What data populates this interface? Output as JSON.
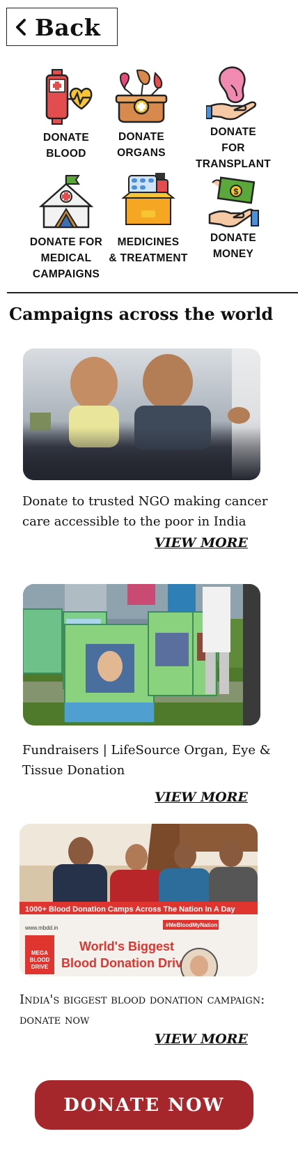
{
  "nav": {
    "back_label": "Back"
  },
  "categories": [
    {
      "label": "DONATE\nBLOOD",
      "icon": "blood-bag-icon"
    },
    {
      "label": "DONATE\nORGANS",
      "icon": "organs-box-icon"
    },
    {
      "label": "DONATE\nFOR\nTRANSPLANT",
      "icon": "kidney-hand-icon"
    },
    {
      "label": "DONATE FOR\nMEDICAL\nCAMPAIGNS",
      "icon": "medical-tent-icon"
    },
    {
      "label": "MEDICINES\n& TREATMENT",
      "icon": "medicine-box-icon"
    },
    {
      "label": "DONATE\nMONEY",
      "icon": "money-hand-icon"
    }
  ],
  "section": {
    "title": "Campaigns across the world"
  },
  "campaigns": [
    {
      "description": "Donate to trusted NGO making cancer care accessible to the poor in India",
      "view_more": "VIEW MORE",
      "image": "children-photo"
    },
    {
      "description": "Fundraisers | LifeSource Organ, Eye & Tissue Donation",
      "view_more": "VIEW MORE",
      "image": "organ-donation-boards-photo"
    },
    {
      "description": "India's biggest blood donation campaign: donate now",
      "view_more": "VIEW MORE",
      "image": "blood-drive-banner-photo",
      "banner": {
        "line1": "1000+ Blood Donation Camps Across The Nation In A Day",
        "tag": "#MeBloodMyNation",
        "title1": "World's Biggest",
        "title2": "Blood Donation Drive",
        "logo_line1": "MEGA",
        "logo_line2": "BLOOD",
        "logo_line3": "DRIVE",
        "site": "www.mbdd.in"
      }
    }
  ],
  "cta": {
    "label": "DONATE  NOW"
  },
  "colors": {
    "accent": "#a5272b",
    "text": "#111111",
    "background": "#ffffff"
  }
}
